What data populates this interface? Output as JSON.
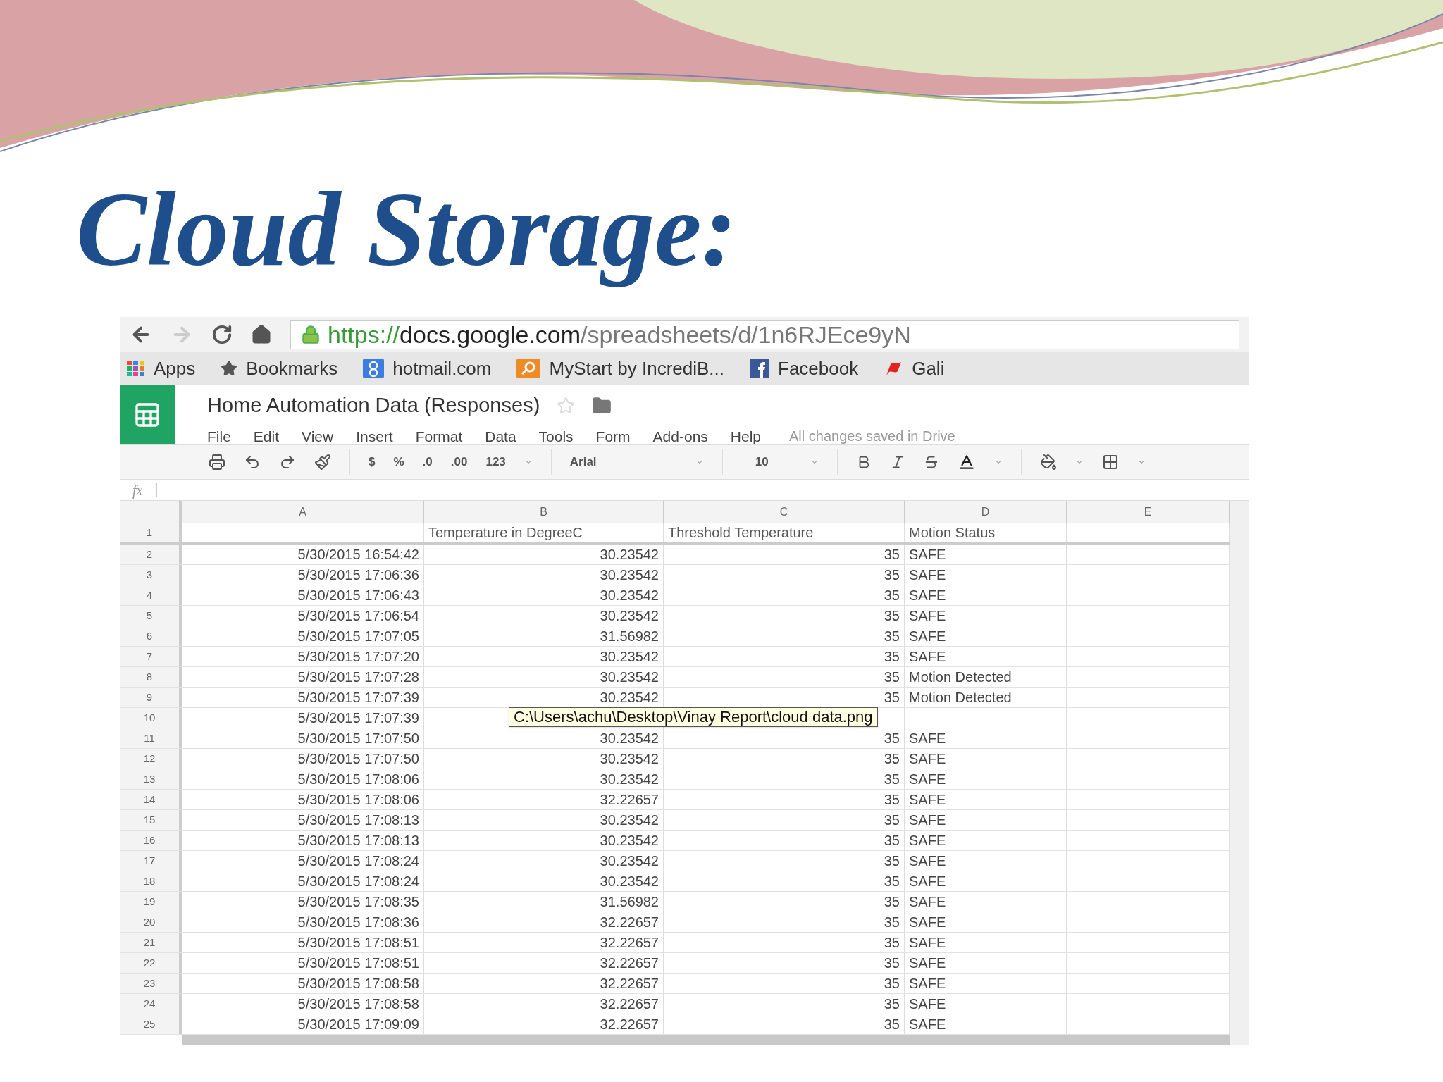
{
  "slide_title": "Cloud Storage:",
  "browser": {
    "url": {
      "scheme": "https://",
      "host": "docs.google.com",
      "path": "/spreadsheets/d/1n6RJEce9yN"
    },
    "bookmarks": [
      "Apps",
      "Bookmarks",
      "hotmail.com",
      "MyStart by IncrediB...",
      "Facebook",
      "Gali"
    ]
  },
  "sheet": {
    "title": "Home Automation Data (Responses)",
    "menu": [
      "File",
      "Edit",
      "View",
      "Insert",
      "Format",
      "Data",
      "Tools",
      "Form",
      "Add-ons",
      "Help"
    ],
    "save_status": "All changes saved in Drive",
    "toolbar": {
      "number_formats": [
        "$",
        "%",
        ".0",
        ".00",
        "123"
      ],
      "font": "Arial",
      "font_size": "10"
    },
    "formula_label": "fx",
    "columns": [
      "A",
      "B",
      "C",
      "D",
      "E"
    ],
    "header_row": {
      "number": "1",
      "b": "Temperature in DegreeC",
      "c": "Threshold Temperature",
      "d": "Motion Status"
    },
    "rows": [
      {
        "number": "2",
        "timestamp": "5/30/2015 16:54:42",
        "temperature": "30.23542",
        "threshold": "35",
        "status": "SAFE"
      },
      {
        "number": "3",
        "timestamp": "5/30/2015 17:06:36",
        "temperature": "30.23542",
        "threshold": "35",
        "status": "SAFE"
      },
      {
        "number": "4",
        "timestamp": "5/30/2015 17:06:43",
        "temperature": "30.23542",
        "threshold": "35",
        "status": "SAFE"
      },
      {
        "number": "5",
        "timestamp": "5/30/2015 17:06:54",
        "temperature": "30.23542",
        "threshold": "35",
        "status": "SAFE"
      },
      {
        "number": "6",
        "timestamp": "5/30/2015 17:07:05",
        "temperature": "31.56982",
        "threshold": "35",
        "status": "SAFE"
      },
      {
        "number": "7",
        "timestamp": "5/30/2015 17:07:20",
        "temperature": "30.23542",
        "threshold": "35",
        "status": "SAFE"
      },
      {
        "number": "8",
        "timestamp": "5/30/2015 17:07:28",
        "temperature": "30.23542",
        "threshold": "35",
        "status": "Motion Detected"
      },
      {
        "number": "9",
        "timestamp": "5/30/2015 17:07:39",
        "temperature": "30.23542",
        "threshold": "35",
        "status": "Motion Detected"
      },
      {
        "number": "10",
        "timestamp": "5/30/2015 17:07:39"
      },
      {
        "number": "11",
        "timestamp": "5/30/2015 17:07:50",
        "temperature": "30.23542",
        "threshold": "35",
        "status": "SAFE"
      },
      {
        "number": "12",
        "timestamp": "5/30/2015 17:07:50",
        "temperature": "30.23542",
        "threshold": "35",
        "status": "SAFE"
      },
      {
        "number": "13",
        "timestamp": "5/30/2015 17:08:06",
        "temperature": "30.23542",
        "threshold": "35",
        "status": "SAFE"
      },
      {
        "number": "14",
        "timestamp": "5/30/2015 17:08:06",
        "temperature": "32.22657",
        "threshold": "35",
        "status": "SAFE"
      },
      {
        "number": "15",
        "timestamp": "5/30/2015 17:08:13",
        "temperature": "30.23542",
        "threshold": "35",
        "status": "SAFE"
      },
      {
        "number": "16",
        "timestamp": "5/30/2015 17:08:13",
        "temperature": "30.23542",
        "threshold": "35",
        "status": "SAFE"
      },
      {
        "number": "17",
        "timestamp": "5/30/2015 17:08:24",
        "temperature": "30.23542",
        "threshold": "35",
        "status": "SAFE"
      },
      {
        "number": "18",
        "timestamp": "5/30/2015 17:08:24",
        "temperature": "30.23542",
        "threshold": "35",
        "status": "SAFE"
      },
      {
        "number": "19",
        "timestamp": "5/30/2015 17:08:35",
        "temperature": "31.56982",
        "threshold": "35",
        "status": "SAFE"
      },
      {
        "number": "20",
        "timestamp": "5/30/2015 17:08:36",
        "temperature": "32.22657",
        "threshold": "35",
        "status": "SAFE"
      },
      {
        "number": "21",
        "timestamp": "5/30/2015 17:08:51",
        "temperature": "32.22657",
        "threshold": "35",
        "status": "SAFE"
      },
      {
        "number": "22",
        "timestamp": "5/30/2015 17:08:51",
        "temperature": "32.22657",
        "threshold": "35",
        "status": "SAFE"
      },
      {
        "number": "23",
        "timestamp": "5/30/2015 17:08:58",
        "temperature": "32.22657",
        "threshold": "35",
        "status": "SAFE"
      },
      {
        "number": "24",
        "timestamp": "5/30/2015 17:08:58",
        "temperature": "32.22657",
        "threshold": "35",
        "status": "SAFE"
      },
      {
        "number": "25",
        "timestamp": "5/30/2015 17:09:09",
        "temperature": "32.22657",
        "threshold": "35",
        "status": "SAFE"
      }
    ],
    "tooltip": "C:\\Users\\achu\\Desktop\\Vinay Report\\cloud data.png"
  }
}
